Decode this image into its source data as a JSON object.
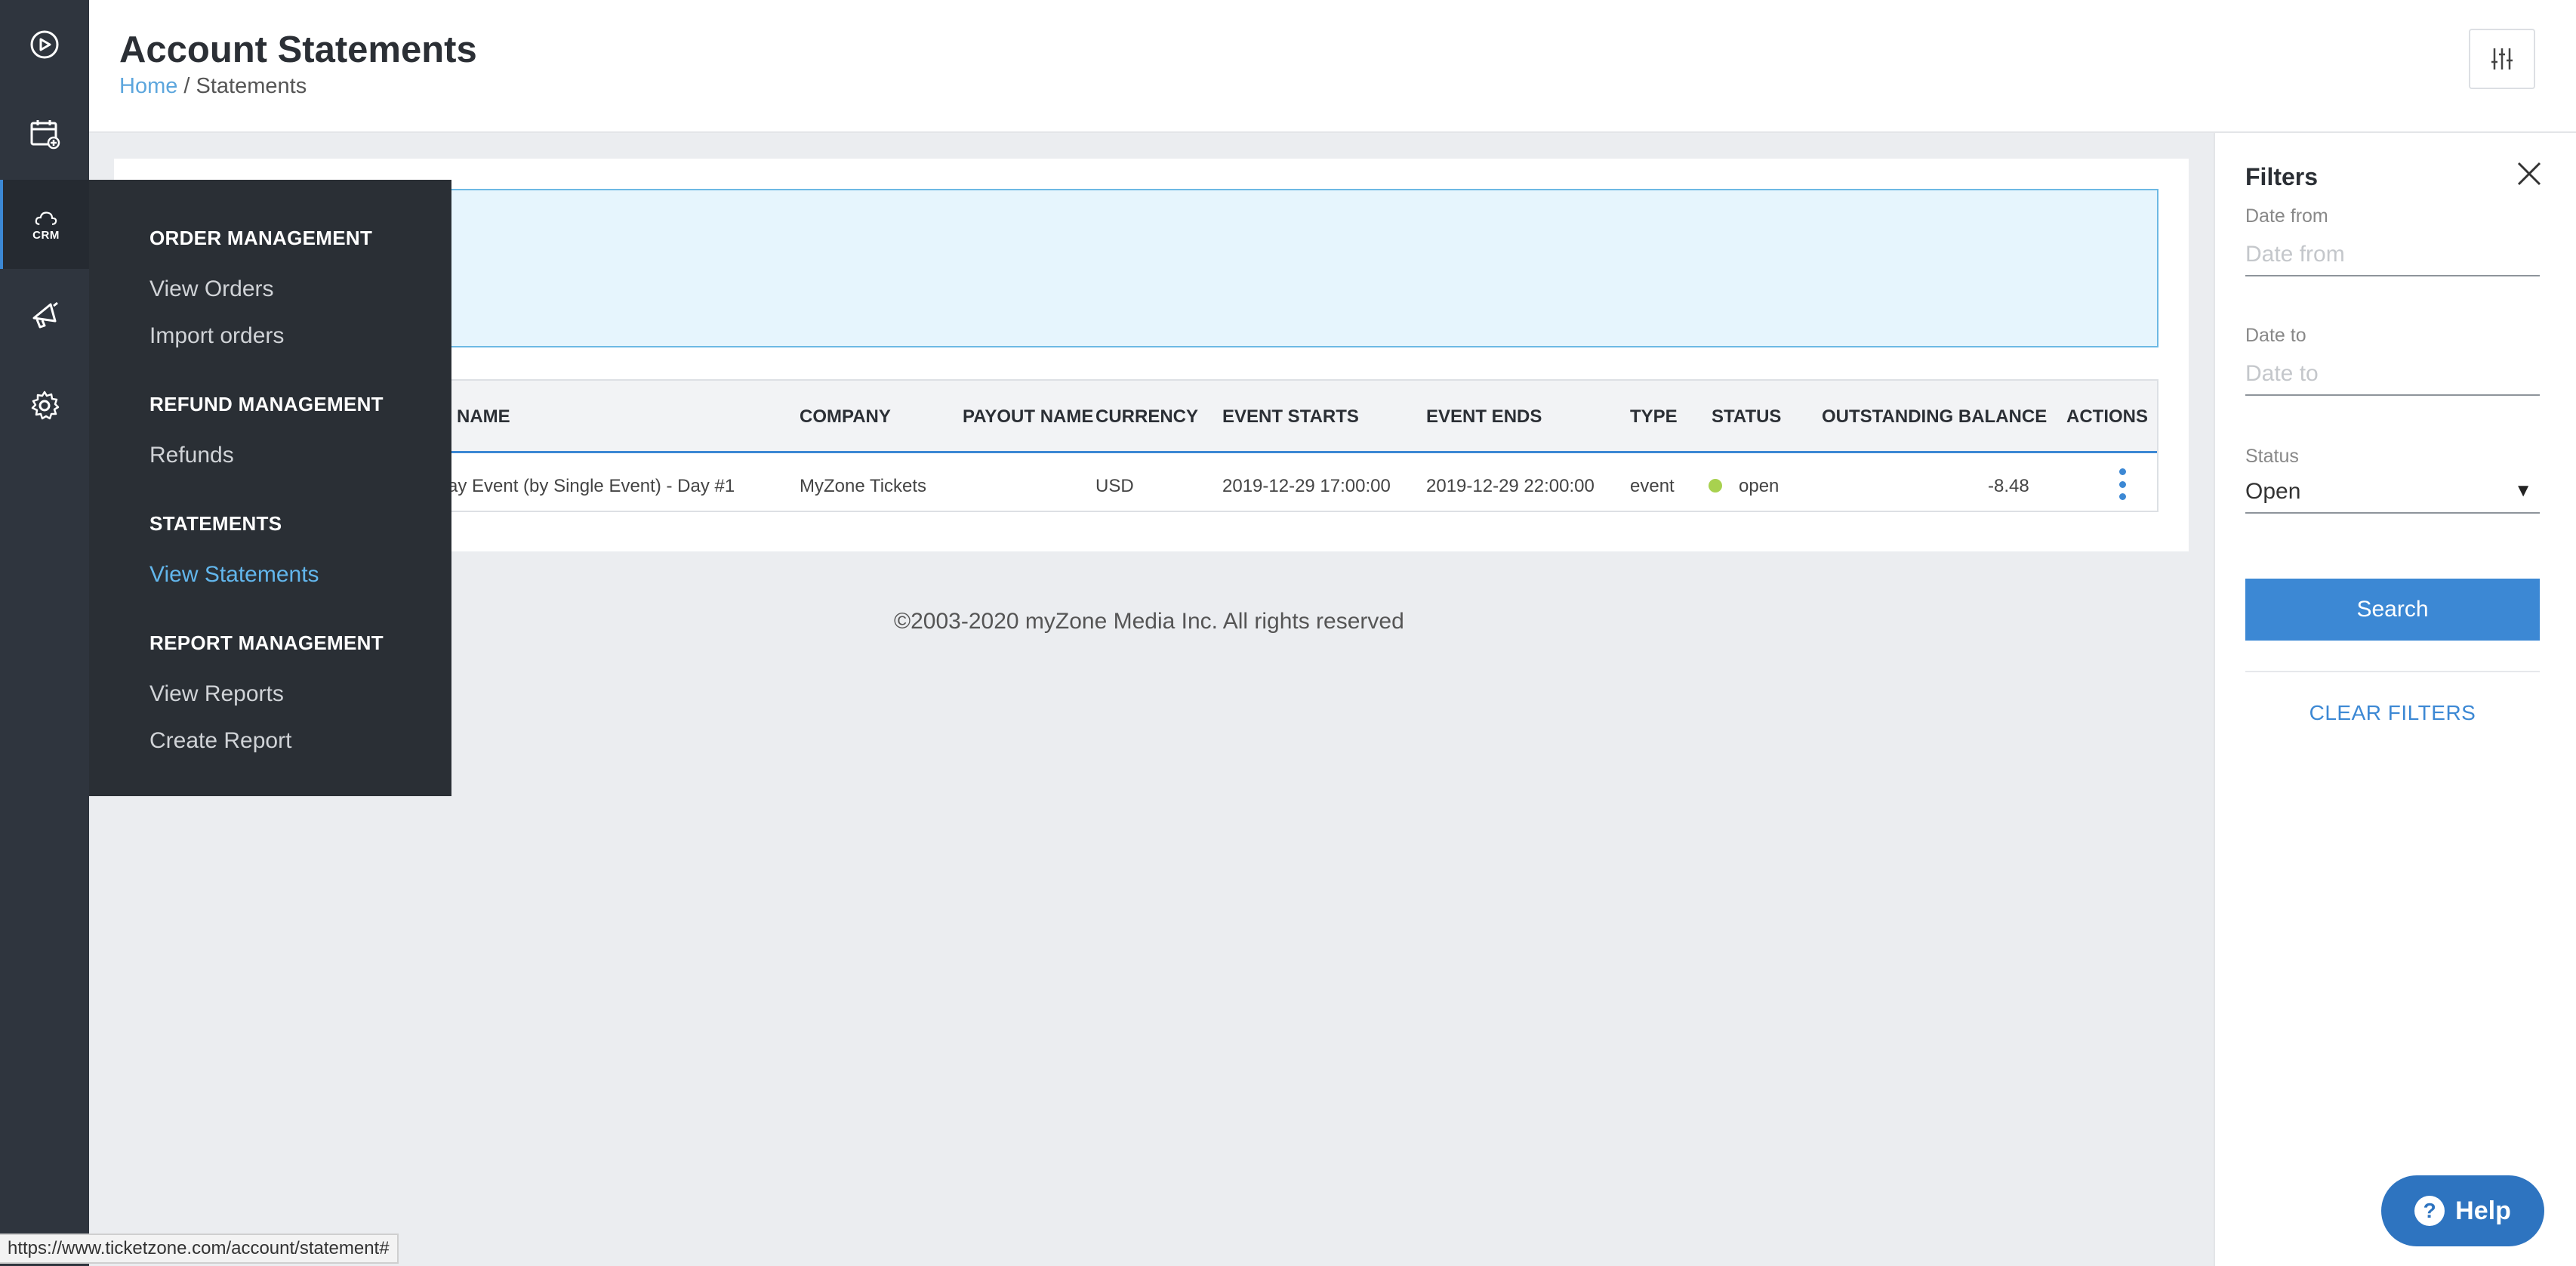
{
  "header": {
    "title": "Account Statements",
    "breadcrumb": {
      "home": "Home",
      "separator": " / ",
      "current": "Statements"
    }
  },
  "rail": {
    "items": [
      {
        "icon": "dashboard-icon"
      },
      {
        "icon": "calendar-add-icon"
      },
      {
        "icon": "crm-cloud-icon",
        "label": "CRM",
        "active": true
      },
      {
        "icon": "megaphone-icon"
      },
      {
        "icon": "gear-icon"
      }
    ]
  },
  "menu": {
    "sections": [
      {
        "title": "ORDER MANAGEMENT",
        "links": [
          "View Orders",
          "Import orders"
        ]
      },
      {
        "title": "REFUND MANAGEMENT",
        "links": [
          "Refunds"
        ]
      },
      {
        "title": "STATEMENTS",
        "links": [
          "View Statements"
        ]
      },
      {
        "title": "REPORT MANAGEMENT",
        "links": [
          "View Reports",
          "Create Report"
        ]
      }
    ],
    "active_link": "View Statements"
  },
  "table": {
    "columns": [
      "NAME",
      "COMPANY",
      "PAYOUT NAME",
      "CURRENCY",
      "EVENT STARTS",
      "EVENT ENDS",
      "TYPE",
      "STATUS",
      "OUTSTANDING BALANCE",
      "ACTIONS"
    ],
    "rows": [
      {
        "name": "ay Event (by Single Event) - Day #1",
        "company": "MyZone Tickets",
        "payout_name": "",
        "currency": "USD",
        "event_starts": "2019-12-29 17:00:00",
        "event_ends": "2019-12-29 22:00:00",
        "type": "event",
        "status": "open",
        "outstanding_balance": "-8.48"
      }
    ]
  },
  "footer": {
    "copyright": "©2003-2020 myZone Media Inc. All rights reserved"
  },
  "filters": {
    "title": "Filters",
    "date_from": {
      "label": "Date from",
      "placeholder": "Date from",
      "value": ""
    },
    "date_to": {
      "label": "Date to",
      "placeholder": "Date to",
      "value": ""
    },
    "status": {
      "label": "Status",
      "value": "Open"
    },
    "search_label": "Search",
    "clear_label": "CLEAR FILTERS"
  },
  "help": {
    "label": "Help"
  },
  "status_bar": {
    "url": "https://www.ticketzone.com/account/statement#"
  },
  "colors": {
    "accent": "#3c88d4",
    "sidebar": "#2f353e",
    "status_open": "#a8d14f",
    "info_bg": "#e6f5fd"
  }
}
